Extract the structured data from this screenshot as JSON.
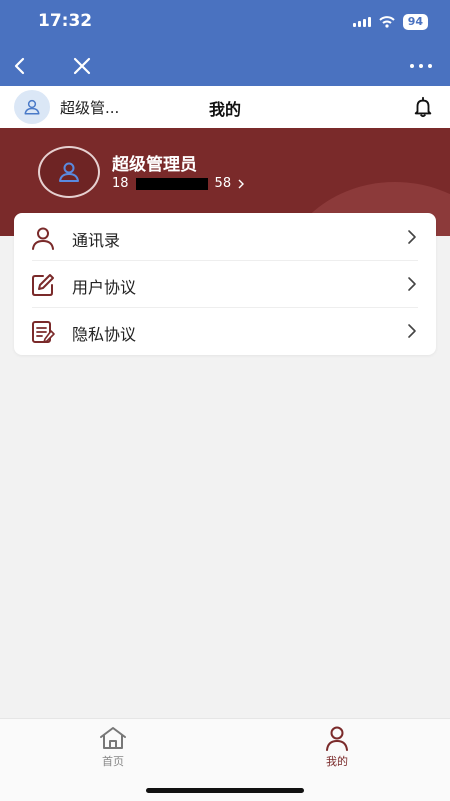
{
  "status_bar": {
    "time": "17:32",
    "battery": "94"
  },
  "navbar": {
    "back_icon": "chevron-left-icon",
    "close_icon": "close-icon",
    "more_icon": "more-dots-icon"
  },
  "header": {
    "user_name_short": "超级管...",
    "title": "我的",
    "bell_icon": "bell-icon"
  },
  "profile": {
    "name": "超级管理员",
    "phone_prefix": "18",
    "phone_suffix": "58"
  },
  "menu": {
    "items": [
      {
        "label": "通讯录",
        "icon": "user-icon"
      },
      {
        "label": "用户协议",
        "icon": "edit-icon"
      },
      {
        "label": "隐私协议",
        "icon": "document-icon"
      }
    ]
  },
  "tabs": [
    {
      "label": "首页",
      "icon": "home-icon",
      "active": false
    },
    {
      "label": "我的",
      "icon": "user-icon",
      "active": true
    }
  ],
  "colors": {
    "primary_blue": "#4a72c0",
    "hero_red": "#7a2a2a",
    "accent": "#7a2a2a",
    "inactive_tab": "#888888"
  }
}
